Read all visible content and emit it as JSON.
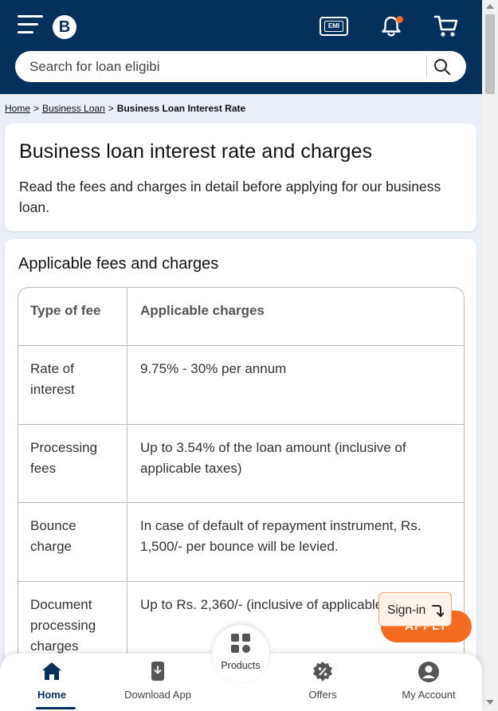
{
  "header": {
    "logo_text": "B",
    "emi_label": "EMI",
    "search_placeholder": "Search for loan eligibi",
    "accent_color": "#06305c",
    "notification_dot_color": "#f26b21"
  },
  "breadcrumb": {
    "items": [
      "Home",
      "Business Loan"
    ],
    "current": "Business Loan Interest Rate"
  },
  "intro": {
    "title": "Business loan interest rate and charges",
    "description": "Read the fees and charges in detail before applying for our business loan."
  },
  "fees": {
    "heading": "Applicable fees and charges",
    "columns": [
      "Type of fee",
      "Applicable charges"
    ],
    "rows": [
      {
        "type": "Rate of interest",
        "charge": "9.75% - 30% per annum"
      },
      {
        "type": "Processing fees",
        "charge": "Up to 3.54% of the loan amount (inclusive of applicable taxes)"
      },
      {
        "type": "Bounce charge",
        "charge": "In case of default of repayment instrument, Rs. 1,500/- per bounce will be levied."
      },
      {
        "type": "Document processing charges",
        "charge": "Up to Rs. 2,360/- (inclusive of applicable taxes)"
      }
    ]
  },
  "floating": {
    "apply_label": "APPLY",
    "signin_label": "Sign-in"
  },
  "bottom_nav": {
    "home": "Home",
    "download": "Download App",
    "products": "Products",
    "offers": "Offers",
    "account": "My Account"
  }
}
